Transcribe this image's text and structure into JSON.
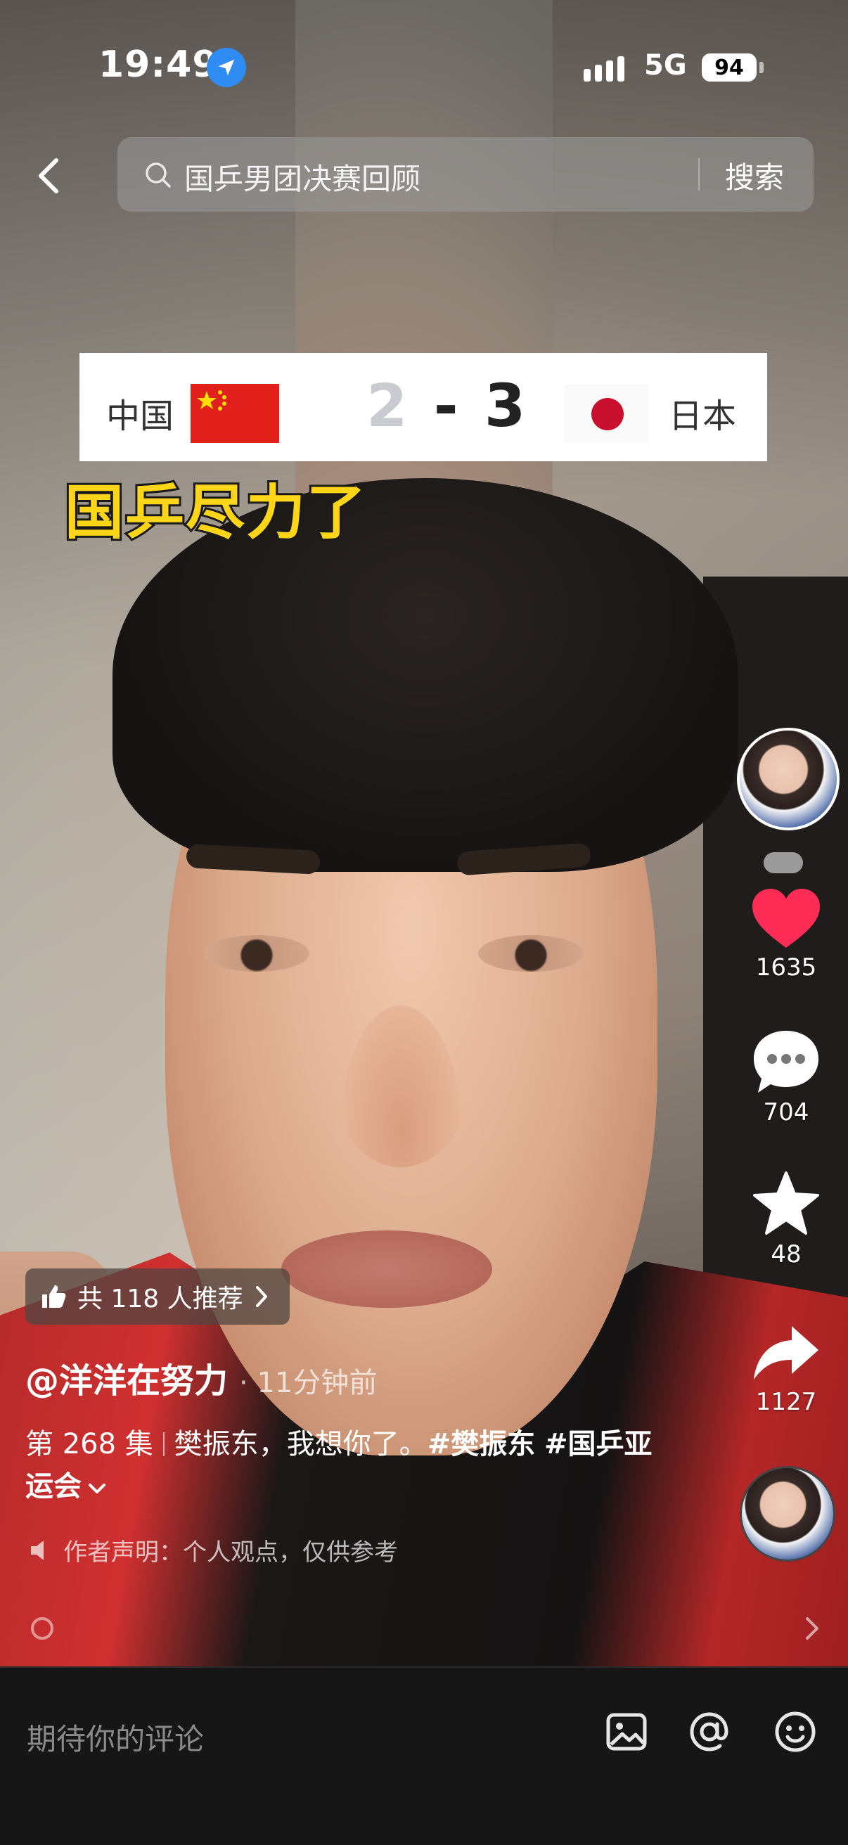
{
  "status_bar": {
    "time": "19:49",
    "network": "5G",
    "battery": "94"
  },
  "search": {
    "query": "国乒男团决赛回顾",
    "button": "搜索"
  },
  "video_overlay": {
    "team_left": "中国",
    "score_left": "2",
    "score_sep": "-",
    "score_right": "3",
    "team_right": "日本",
    "caption": "国乒尽力了"
  },
  "actions": {
    "likes": "1635",
    "comments": "704",
    "favorites": "48",
    "shares": "1127"
  },
  "info": {
    "recommend": "共 118 人推荐",
    "author": "@洋洋在努力",
    "time_ago": "11分钟前",
    "episode": "第 268 集",
    "description": "樊振东，我想你了。",
    "tag1": "#樊振东",
    "tag2": "#国乒亚运会",
    "statement": "作者声明：个人观点，仅供参考"
  },
  "comment": {
    "placeholder": "期待你的评论"
  },
  "colors": {
    "like": "#ff2d55",
    "caption": "#ffd51a",
    "location": "#2f8cf2"
  }
}
